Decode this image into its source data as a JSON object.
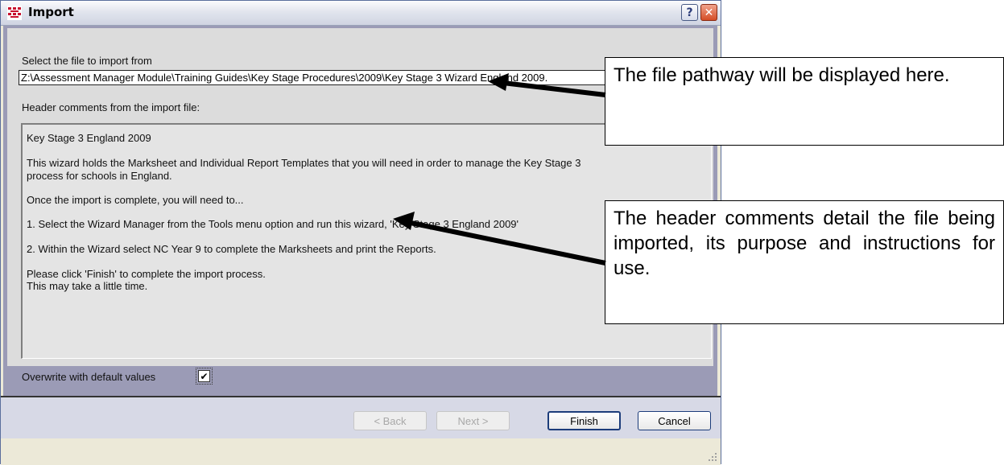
{
  "window": {
    "title": "Import",
    "help_glyph": "?",
    "close_glyph": "✕"
  },
  "form": {
    "select_label": "Select the file to import from",
    "file_path": "Z:\\Assessment Manager Module\\Training Guides\\Key Stage Procedures\\2009\\Key Stage 3 Wizard England 2009.",
    "header_label": "Header comments from the import file:",
    "comments": [
      "Key Stage 3 England 2009",
      "This wizard holds the Marksheet and Individual Report Templates that you will need in order to manage the Key Stage 3",
      "process for schools in England.",
      "Once the import is complete, you will need to...",
      "1.  Select the Wizard Manager from the Tools menu option and run this wizard, 'Key Stage 3 England 2009'",
      "2.  Within the Wizard select NC Year 9 to complete the Marksheets and print the Reports.",
      "Please click 'Finish' to complete the import process.",
      "This may take a little time."
    ],
    "overwrite_label": "Overwrite with default values",
    "overwrite_checked": true,
    "check_glyph": "✔"
  },
  "buttons": {
    "back": "< Back",
    "next": "Next >",
    "finish": "Finish",
    "cancel": "Cancel"
  },
  "callouts": {
    "pathway": "The file pathway will be displayed here.",
    "header": "The header comments detail the file being imported, its purpose and instructions for use."
  },
  "colors": {
    "frame": "#9b9bb6",
    "panel": "#dcdcdc",
    "close_button": "#d44d26"
  },
  "icons": [
    "app-icon",
    "help-icon",
    "close-icon",
    "checkbox-check-icon",
    "arrow-icon",
    "resize-grip-icon"
  ]
}
